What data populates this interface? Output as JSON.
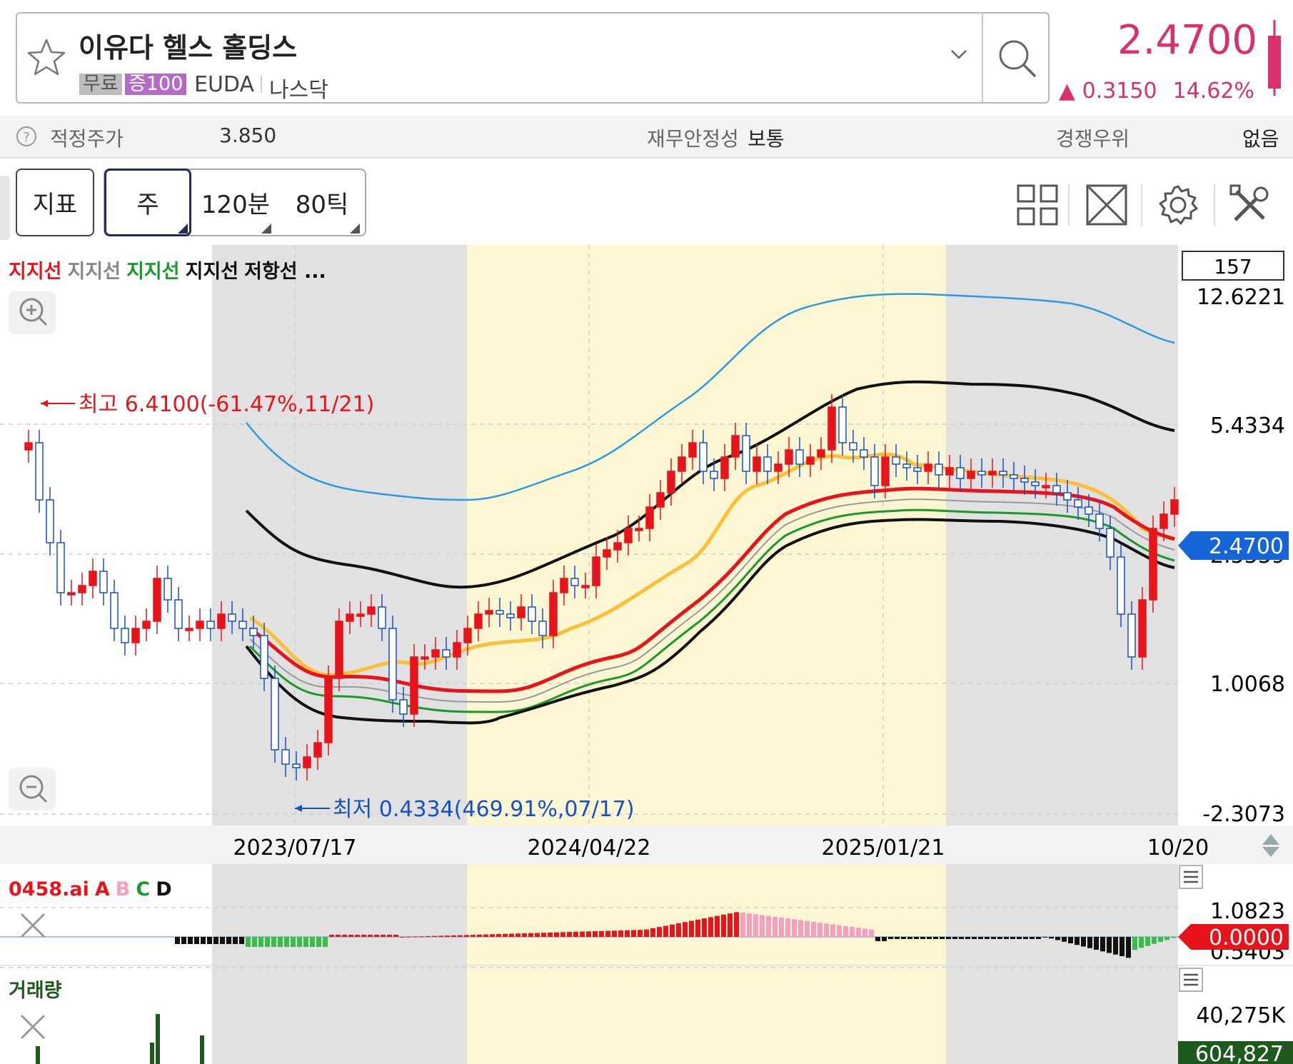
{
  "header": {
    "stock_name": "이유다 헬스 홀딩스",
    "tag_free": "무료",
    "tag_margin": "증100",
    "ticker": "EUDA",
    "market": "나스닥",
    "price": "2.4700",
    "change": "▲ 0.3150",
    "change_pct": "14.62%",
    "favorite_icon": "star-icon",
    "dropdown_icon": "chevron-down-icon",
    "search_icon": "search-icon",
    "price_color": "#d9316e"
  },
  "info_bar": {
    "help_icon": "?",
    "fair_price_label": "적정주가",
    "fair_price_value": "3.850",
    "stability_label": "재무안정성",
    "stability_value": "보통",
    "competitive_label": "경쟁우위",
    "competitive_value": "없음"
  },
  "toolbar": {
    "indicator_label": "지표",
    "periods": [
      "주",
      "120분",
      "80틱"
    ],
    "selected_period": "주",
    "icons": [
      "grid-layout-icon",
      "expand-icon",
      "gear-icon",
      "tools-icon"
    ]
  },
  "chart": {
    "legend": [
      {
        "text": "지지선",
        "color": "#e8141c"
      },
      {
        "text": "지지선",
        "color": "#888888"
      },
      {
        "text": "지지선",
        "color": "#1a9a2a"
      },
      {
        "text": "지지선",
        "color": "#111111"
      },
      {
        "text": "저항선 ...",
        "color": "#111111"
      }
    ],
    "count_box": "157",
    "y_labels": [
      "12.6221",
      "5.4334",
      "2.5559",
      "1.0068",
      "-2.3073"
    ],
    "current_price_tag": "2.4700",
    "high_annotation": "최고 6.4100(-61.47%,11/21)",
    "low_annotation": "최저 0.4334(469.91%,07/17)",
    "x_labels": [
      "2023/07/17",
      "2024/04/22",
      "2025/01/21",
      "10/20"
    ],
    "up_color": "#e8141c",
    "down_color": "#1650c8"
  },
  "oscillator": {
    "title": "0458.ai",
    "legend": [
      {
        "text": "A",
        "color": "#e8141c"
      },
      {
        "text": "B",
        "color": "#f4a0c0"
      },
      {
        "text": "C",
        "color": "#1a9a2a"
      },
      {
        "text": "D",
        "color": "#111111"
      }
    ],
    "y_top": "1.0823",
    "y_zero_tag": "0.0000",
    "y_bottom": "0.5403"
  },
  "volume": {
    "title": "거래량",
    "y_top": "40,275K",
    "last_value_tag": "604,827"
  }
}
